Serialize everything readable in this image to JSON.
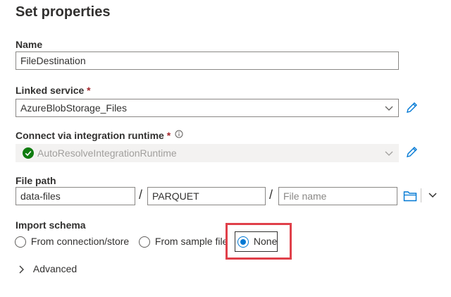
{
  "panel": {
    "title": "Set properties"
  },
  "name_field": {
    "label": "Name",
    "value": "FileDestination"
  },
  "linked_service": {
    "label": "Linked service",
    "required_mark": "*",
    "value": "AzureBlobStorage_Files",
    "edit_icon": "pencil-icon"
  },
  "integration_runtime": {
    "label": "Connect via integration runtime",
    "required_mark": "*",
    "info_icon": "info-icon",
    "status_icon": "check-circle-icon",
    "value": "AutoResolveIntegrationRuntime",
    "edit_icon": "pencil-icon"
  },
  "file_path": {
    "label": "File path",
    "container": "data-files",
    "directory": "PARQUET",
    "file_name_placeholder": "File name",
    "separator": "/",
    "browse_icon": "folder-icon",
    "more_icon": "chevron-down-icon"
  },
  "import_schema": {
    "label": "Import schema",
    "options": [
      "From connection/store",
      "From sample file",
      "None"
    ],
    "selected": "None"
  },
  "advanced": {
    "label": "Advanced",
    "icon": "chevron-right-icon"
  },
  "colors": {
    "accent": "#0078d4",
    "required": "#a4262c",
    "highlight": "#e0404a",
    "success": "#107c10"
  }
}
